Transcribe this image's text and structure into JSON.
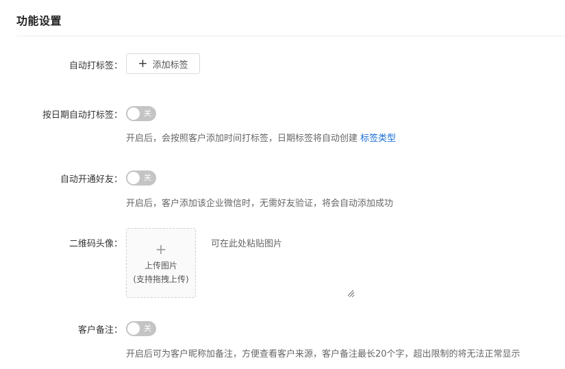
{
  "section": {
    "title": "功能设置"
  },
  "auto_tag": {
    "label": "自动打标签：",
    "add_button": "添加标签"
  },
  "date_tag": {
    "label": "按日期自动打标签：",
    "toggle_text": "关",
    "enabled": false,
    "desc": "开启后，会按照客户添加时间打标签，日期标签将自动创建",
    "link": "标签类型"
  },
  "auto_friend": {
    "label": "自动开通好友：",
    "toggle_text": "关",
    "enabled": false,
    "desc": "开启后，客户添加该企业微信时，无需好友验证，将会自动添加成功"
  },
  "qr_avatar": {
    "label": "二维码头像：",
    "upload_line1": "上传图片",
    "upload_line2": "(支持拖拽上传)",
    "paste_placeholder": "可在此处粘贴图片"
  },
  "customer_note": {
    "label": "客户备注：",
    "toggle_text": "关",
    "enabled": false,
    "desc": "开启后可为客户昵称加备注，方便查看客户来源，客户备注最长20个字，超出限制的将无法正常显示"
  },
  "colors": {
    "link": "#1a6fd6",
    "toggle_off": "#c4c4c4"
  }
}
